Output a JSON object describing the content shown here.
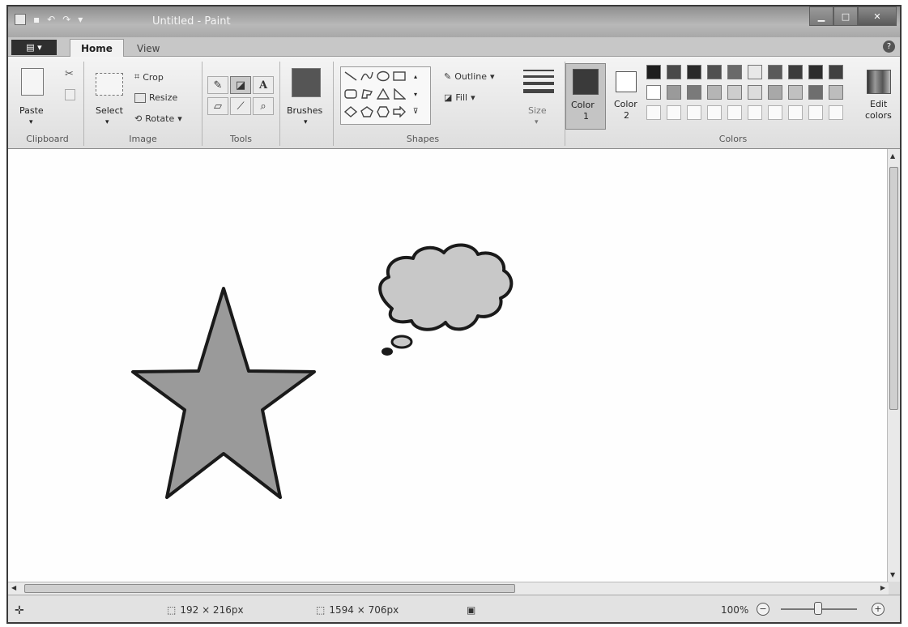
{
  "window": {
    "title": "Untitled - Paint"
  },
  "tabs": {
    "home": "Home",
    "view": "View"
  },
  "ribbon": {
    "clipboard": {
      "paste": "Paste",
      "group": "Clipboard"
    },
    "image": {
      "select": "Select",
      "crop": "Crop",
      "resize": "Resize",
      "rotate": "Rotate",
      "group": "Image"
    },
    "tools": {
      "group": "Tools"
    },
    "brushes": {
      "label": "Brushes"
    },
    "shapes": {
      "outline": "Outline",
      "fill": "Fill",
      "group": "Shapes"
    },
    "size": {
      "label": "Size"
    },
    "colors": {
      "color1": "Color",
      "color1_num": "1",
      "color2": "Color",
      "color2_num": "2",
      "edit": "Edit",
      "edit2": "colors",
      "group": "Colors",
      "color1_value": "#3a3a3a",
      "color2_value": "#ffffff",
      "palette_row1": [
        "#1e1e1e",
        "#4a4a4a",
        "#2a2a2a",
        "#505050",
        "#6a6a6a",
        "#e8e8e8",
        "#5a5a5a",
        "#3c3c3c",
        "#2c2c2c",
        "#404040"
      ],
      "palette_row2": [
        "#ffffff",
        "#9a9a9a",
        "#7a7a7a",
        "#b5b5b5",
        "#cdcdcd",
        "#dcdcdc",
        "#a8a8a8",
        "#c0c0c0",
        "#6e6e6e",
        "#bdbdbd"
      ]
    }
  },
  "status": {
    "selection_size": "192 × 216px",
    "image_size": "1594 × 706px",
    "zoom": "100%"
  },
  "canvas": {
    "star_fill": "#9a9a9a",
    "cloud_fill": "#c8c8c8"
  }
}
